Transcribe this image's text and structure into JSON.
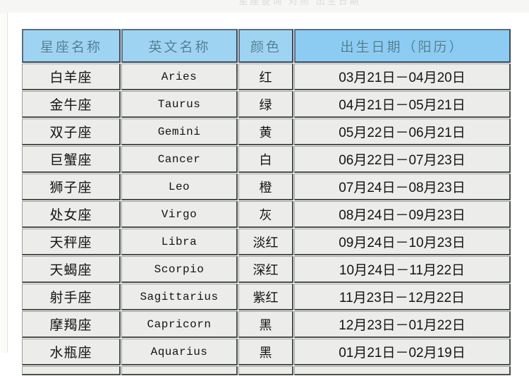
{
  "page": {
    "top_faint_text": "星座查询 对照 出生日期",
    "background_color": "#ffffff"
  },
  "table": {
    "header_bg_color": "#9fd3f2",
    "header_text_color": "#4a7f96",
    "row_bg_color": "#ececea",
    "columns": [
      {
        "key": "name",
        "label": "星座名称"
      },
      {
        "key": "en",
        "label": "英文名称"
      },
      {
        "key": "color",
        "label": "颜色"
      },
      {
        "key": "date",
        "label": "出生日期（阳历）"
      }
    ],
    "rows": [
      {
        "name": "白羊座",
        "en": "Aries",
        "color": "红",
        "date": "03月21日－04月20日"
      },
      {
        "name": "金牛座",
        "en": "Taurus",
        "color": "绿",
        "date": "04月21日－05月21日"
      },
      {
        "name": "双子座",
        "en": "Gemini",
        "color": "黄",
        "date": "05月22日－06月21日"
      },
      {
        "name": "巨蟹座",
        "en": "Cancer",
        "color": "白",
        "date": "06月22日－07月23日"
      },
      {
        "name": "狮子座",
        "en": "Leo",
        "color": "橙",
        "date": "07月24日－08月23日"
      },
      {
        "name": "处女座",
        "en": "Virgo",
        "color": "灰",
        "date": "08月24日－09月23日"
      },
      {
        "name": "天秤座",
        "en": "Libra",
        "color": "淡红",
        "date": "09月24日－10月23日"
      },
      {
        "name": "天蝎座",
        "en": "Scorpio",
        "color": "深红",
        "date": "10月24日－11月22日"
      },
      {
        "name": "射手座",
        "en": "Sagittarius",
        "color": "紫红",
        "date": "11月23日－12月22日"
      },
      {
        "name": "摩羯座",
        "en": "Capricorn",
        "color": "黑",
        "date": "12月23日－01月22日"
      },
      {
        "name": "水瓶座",
        "en": "Aquarius",
        "color": "黑",
        "date": "01月21日－02月19日"
      }
    ],
    "clipped_row": {
      "name": "",
      "en": "",
      "color": "",
      "date": ""
    }
  }
}
